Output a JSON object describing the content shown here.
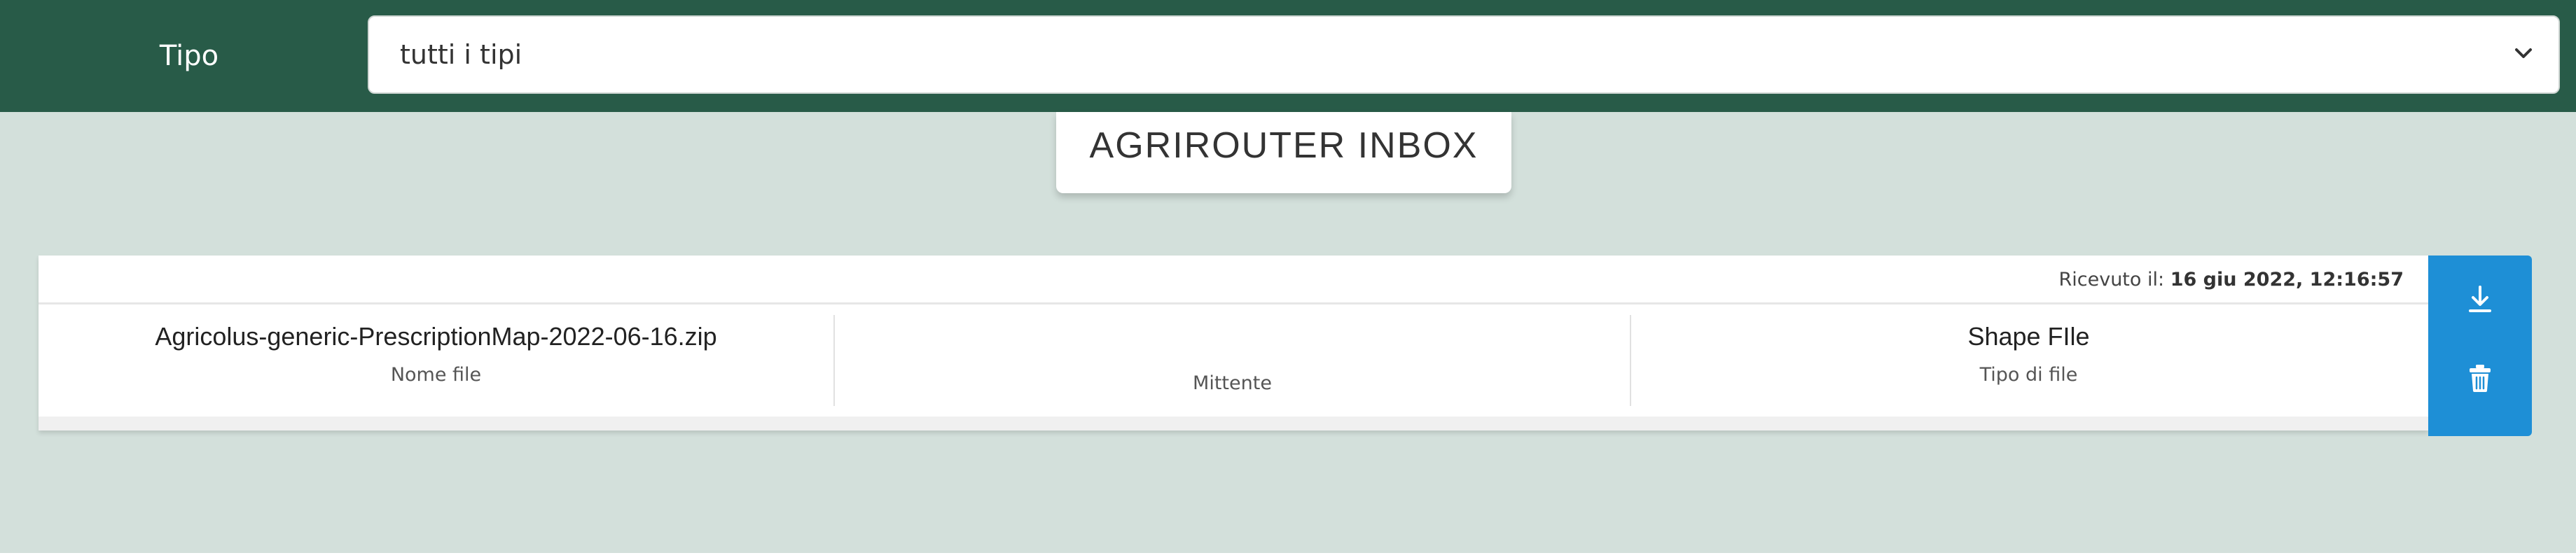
{
  "filter": {
    "label": "Tipo",
    "select_value": "tutti i tipi",
    "icon": "chevron-down-icon"
  },
  "inbox": {
    "title": "AGRIROUTER INBOX",
    "items": [
      {
        "received_label": "Ricevuto il:",
        "received_value": "16 giu 2022, 12:16:57",
        "file_name": "Agricolus-generic-PrescriptionMap-2022-06-16.zip",
        "file_name_caption": "Nome file",
        "sender": "",
        "sender_caption": "Mittente",
        "file_type": "Shape FIle",
        "file_type_caption": "Tipo di file",
        "actions": {
          "download_icon": "download-icon",
          "delete_icon": "trash-icon"
        }
      }
    ]
  },
  "colors": {
    "header_bg": "#285b48",
    "page_bg": "#d3e0db",
    "action_bg": "#1e8fd6"
  }
}
